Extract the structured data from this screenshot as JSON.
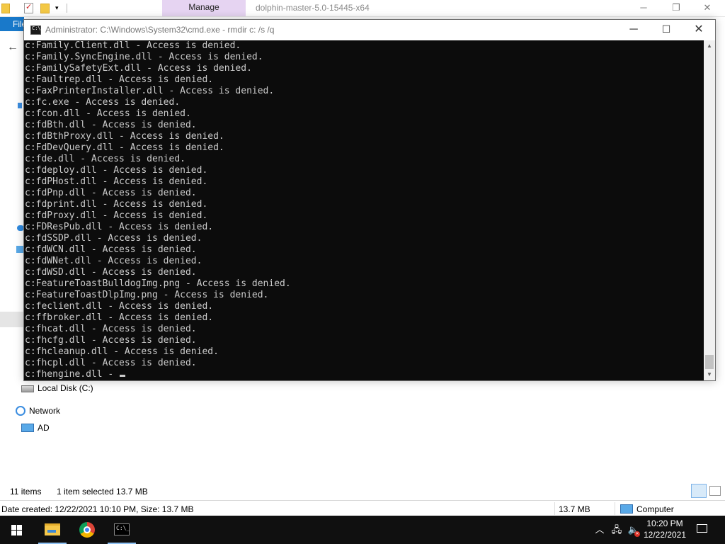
{
  "explorer": {
    "manage_tab": "Manage",
    "title": "dolphin-master-5.0-15445-x64",
    "file_tab": "File",
    "nav": {
      "local_disk": "Local Disk (C:)",
      "network": "Network",
      "ad": "AD"
    },
    "status": {
      "items": "11 items",
      "selected": "1 item selected  13.7 MB"
    },
    "details": {
      "text": "Date created: 12/22/2021 10:10 PM, Size: 13.7 MB",
      "size": "13.7 MB",
      "location": "Computer"
    }
  },
  "cmd": {
    "title": "Administrator: C:\\Windows\\System32\\cmd.exe - rmdir  c: /s /q",
    "lines": [
      "c:Family.Client.dll - Access is denied.",
      "c:Family.SyncEngine.dll - Access is denied.",
      "c:FamilySafetyExt.dll - Access is denied.",
      "c:Faultrep.dll - Access is denied.",
      "c:FaxPrinterInstaller.dll - Access is denied.",
      "c:fc.exe - Access is denied.",
      "c:fcon.dll - Access is denied.",
      "c:fdBth.dll - Access is denied.",
      "c:fdBthProxy.dll - Access is denied.",
      "c:FdDevQuery.dll - Access is denied.",
      "c:fde.dll - Access is denied.",
      "c:fdeploy.dll - Access is denied.",
      "c:fdPHost.dll - Access is denied.",
      "c:fdPnp.dll - Access is denied.",
      "c:fdprint.dll - Access is denied.",
      "c:fdProxy.dll - Access is denied.",
      "c:FDResPub.dll - Access is denied.",
      "c:fdSSDP.dll - Access is denied.",
      "c:fdWCN.dll - Access is denied.",
      "c:fdWNet.dll - Access is denied.",
      "c:fdWSD.dll - Access is denied.",
      "c:FeatureToastBulldogImg.png - Access is denied.",
      "c:FeatureToastDlpImg.png - Access is denied.",
      "c:feclient.dll - Access is denied.",
      "c:ffbroker.dll - Access is denied.",
      "c:fhcat.dll - Access is denied.",
      "c:fhcfg.dll - Access is denied.",
      "c:fhcleanup.dll - Access is denied.",
      "c:fhcpl.dll - Access is denied.",
      "c:fhengine.dll - "
    ]
  },
  "taskbar": {
    "time": "10:20 PM",
    "date": "12/22/2021"
  },
  "icons": {
    "start": "windows-logo-icon",
    "explorer": "folder-icon",
    "chrome": "chrome-icon",
    "cmd": "terminal-icon",
    "network": "network-icon",
    "volume": "volume-muted-icon",
    "notifications": "notification-icon"
  },
  "colors": {
    "console_bg": "#0c0c0c",
    "console_text": "#cccccc",
    "taskbar": "#101010",
    "manage_tab": "#e6d4f2",
    "file_tab": "#1979ca"
  }
}
